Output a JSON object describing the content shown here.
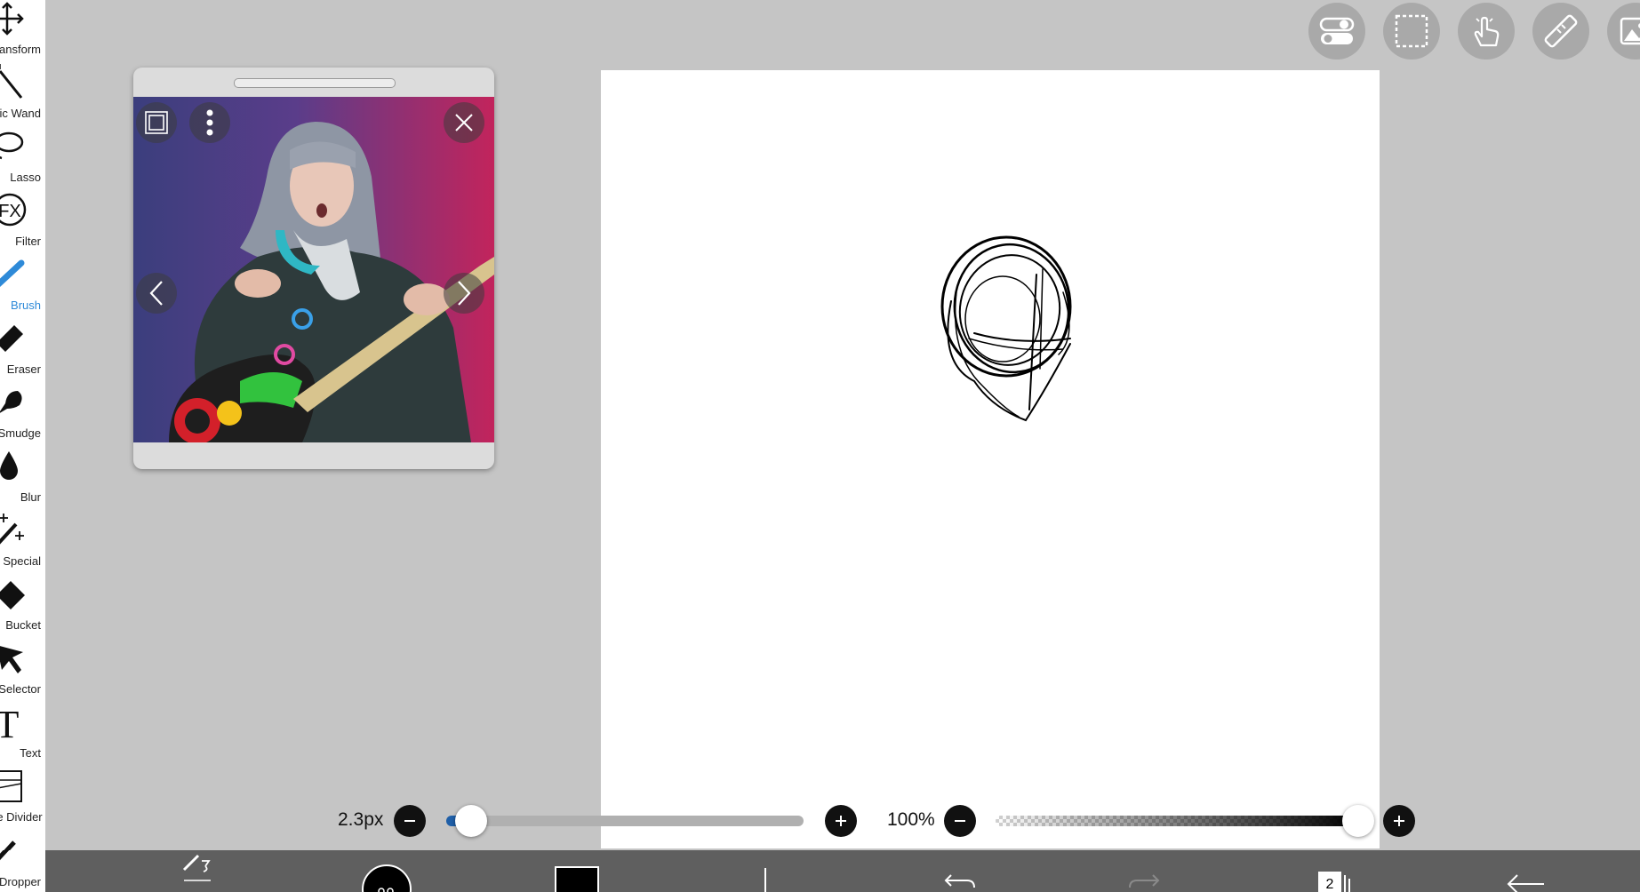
{
  "sidebar": {
    "tools": [
      {
        "label": "Transform",
        "icon": "move-arrows-icon"
      },
      {
        "label": "Magic Wand",
        "icon": "magic-wand-icon"
      },
      {
        "label": "Lasso",
        "icon": "lasso-icon"
      },
      {
        "label": "Filter",
        "icon": "fx-filter-icon"
      },
      {
        "label": "Brush",
        "icon": "brush-icon",
        "active": true
      },
      {
        "label": "Eraser",
        "icon": "eraser-icon"
      },
      {
        "label": "Smudge",
        "icon": "smudge-icon"
      },
      {
        "label": "Blur",
        "icon": "blur-drop-icon"
      },
      {
        "label": "Special",
        "icon": "special-sparkle-icon"
      },
      {
        "label": "Bucket",
        "icon": "bucket-icon"
      },
      {
        "label": "Selector",
        "icon": "selector-arrow-icon"
      },
      {
        "label": "Text",
        "icon": "text-t-icon"
      },
      {
        "label": "Frame Divider",
        "icon": "frame-divider-icon"
      },
      {
        "label": "Dropper",
        "icon": "dropper-icon"
      }
    ]
  },
  "top_buttons": [
    "toggle-settings-icon",
    "selection-rect-icon",
    "hand-gesture-icon",
    "ruler-icon",
    "reference-image-icon"
  ],
  "reference_window": {
    "buttons": [
      "fit-frame-icon",
      "more-vertical-icon",
      "close-icon",
      "previous-chevron-icon",
      "next-chevron-icon"
    ]
  },
  "brush_size": {
    "value_text": "2.3px",
    "slider_fraction": 0.07
  },
  "opacity": {
    "value_text": "100%",
    "slider_fraction": 1.0
  },
  "bottom_bar": {
    "items": [
      "brush-settings-icon",
      "brush-preview-icon",
      "color-swatch-icon",
      "import-down-icon",
      "undo-icon",
      "redo-icon",
      "layers-icon",
      "back-arrow-icon"
    ],
    "layer_count": "2",
    "color": "#000000"
  },
  "colors": {
    "accent": "#2e8ad8",
    "workspace": "#c5c5c5",
    "bottom_bar": "#5f5f5f",
    "slider_fill": "#1f5fa8"
  }
}
